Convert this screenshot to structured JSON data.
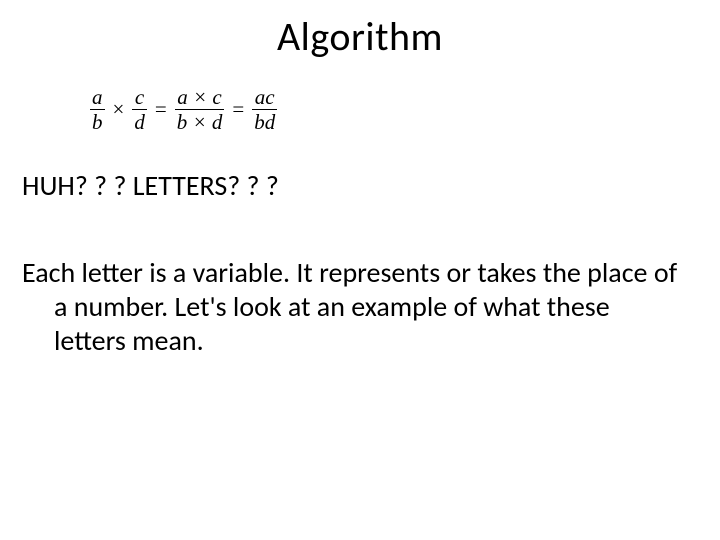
{
  "title": "Algorithm",
  "formula": {
    "f1": {
      "num": "a",
      "den": "b"
    },
    "times": "×",
    "f2": {
      "num": "c",
      "den": "d"
    },
    "eq": "=",
    "f3": {
      "num": "a × c",
      "den": "b × d"
    },
    "f4": {
      "num": "ac",
      "den": "bd"
    }
  },
  "huh": "HUH? ? ?  LETTERS? ? ?",
  "body": "Each letter is a variable.  It represents or takes the place of a number.  Let's look at an example of what these letters mean."
}
